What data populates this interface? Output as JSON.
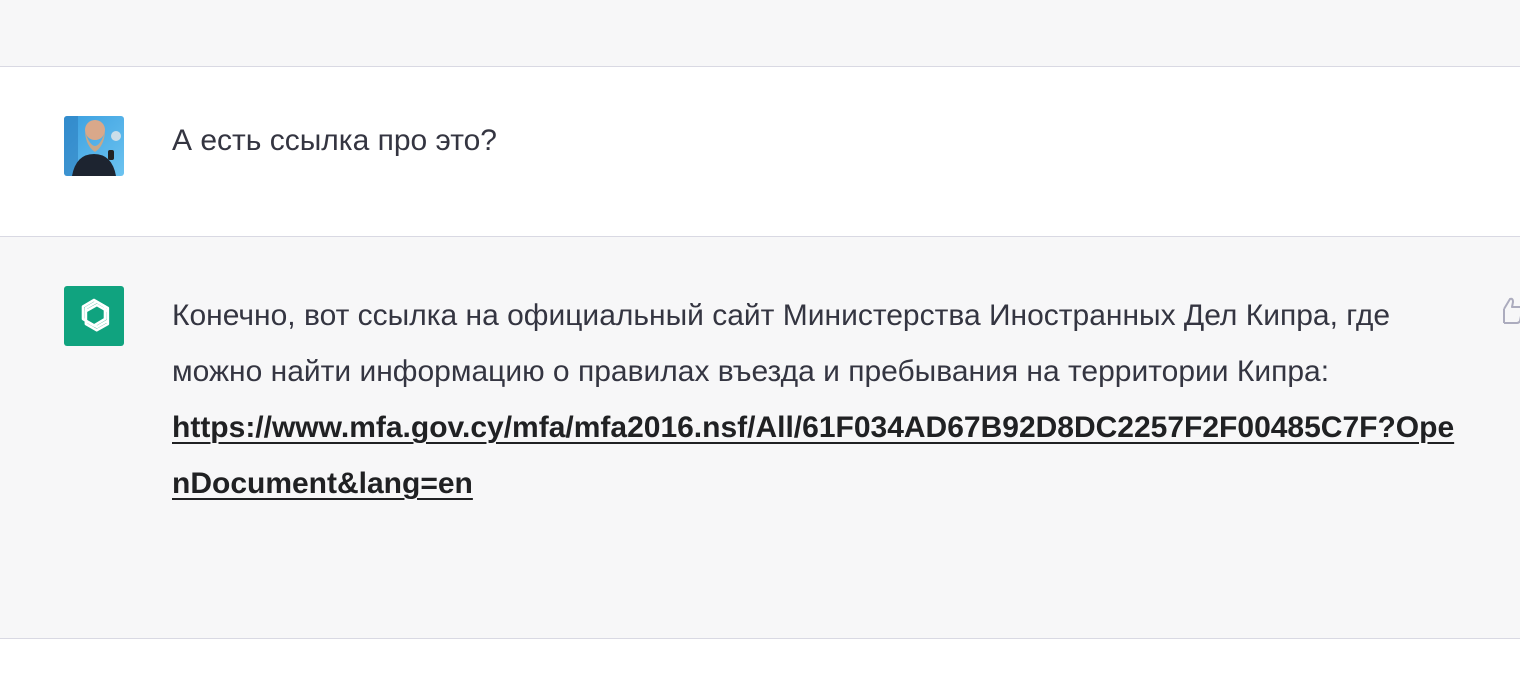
{
  "conversation": {
    "user_message": {
      "avatar": "user-photo-avatar",
      "text": "А есть ссылка про это?"
    },
    "assistant_message": {
      "avatar": "openai-logo-icon",
      "text": "Конечно, вот ссылка на официальный сайт Министерства Иностранных Дел Кипра, где можно найти информацию о правилах въезда и пребывания на территории Кипра:",
      "link": "https://www.mfa.gov.cy/mfa/mfa2016.nsf/All/61F034AD67B92D8DC2257F2F00485C7F?OpenDocument&lang=en",
      "feedback_icon": "thumbs-up-icon"
    }
  },
  "colors": {
    "assistant_bg": "#f7f7f8",
    "user_bg": "#ffffff",
    "brand_green": "#10a37f",
    "text": "#343541"
  }
}
